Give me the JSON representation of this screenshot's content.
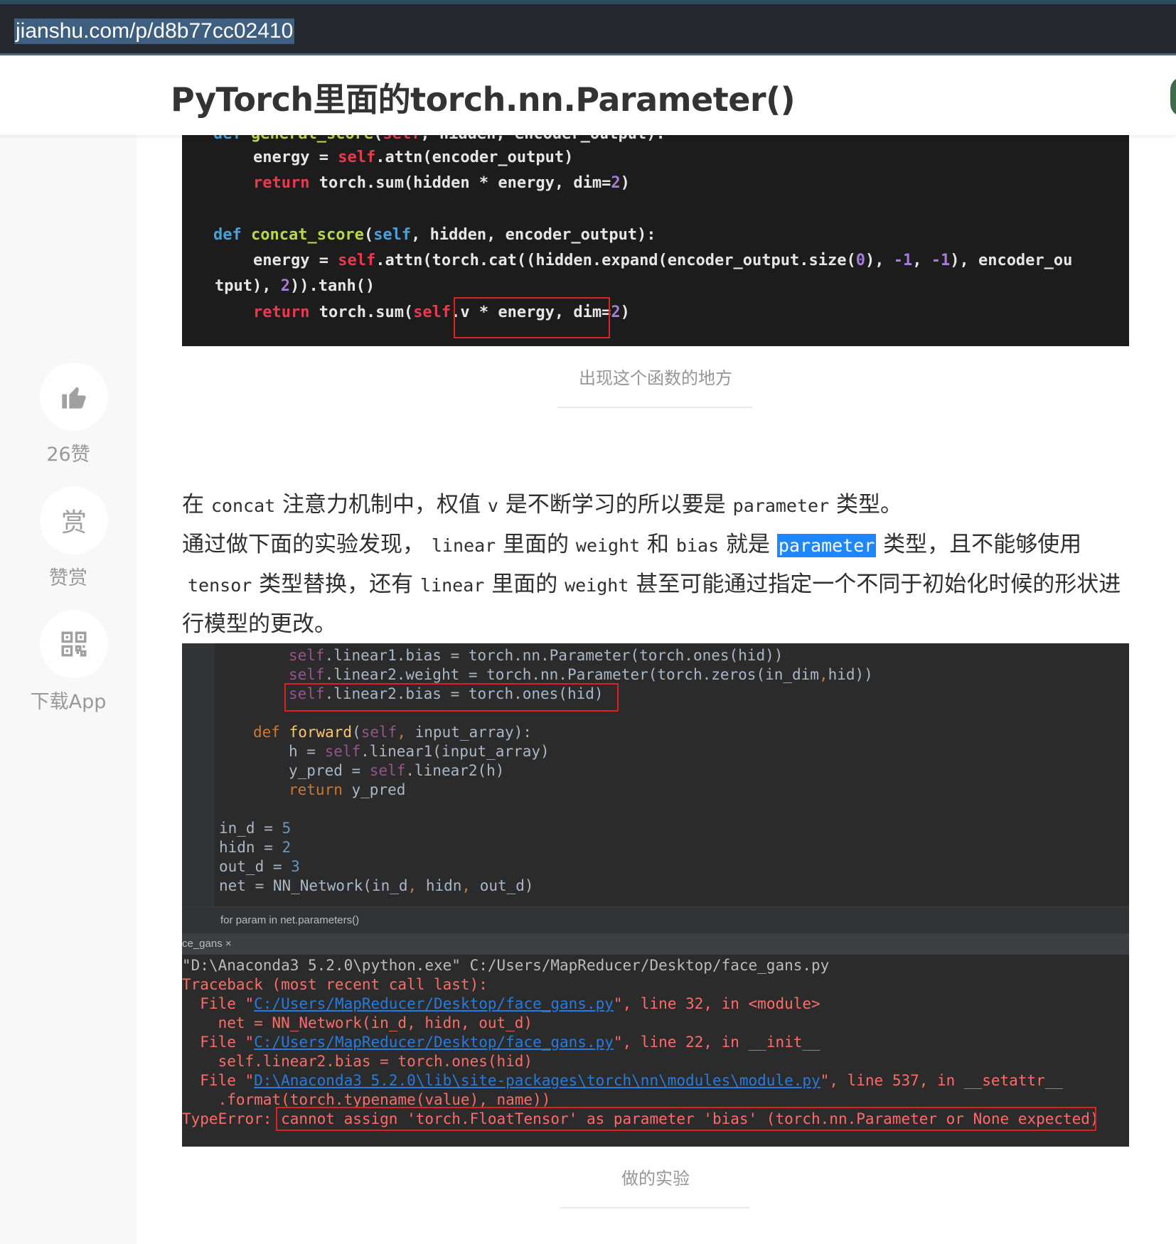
{
  "browser": {
    "url": "jianshu.com/p/d8b77cc02410"
  },
  "header": {
    "title": "PyTorch里面的torch.nn.Parameter()"
  },
  "sidebar": {
    "like_count": "26赞",
    "reward_label": "赞赏",
    "reward_icon_char": "赏",
    "download_label": "下载App"
  },
  "code_block_1": {
    "lines": [
      "    def general_score(self, hidden, encoder_output):",
      "        energy = self.attn(encoder_output)",
      "        return torch.sum(hidden * energy, dim=2)",
      "",
      "    def concat_score(self, hidden, encoder_output):",
      "        energy = self.attn(torch.cat((hidden.expand(encoder_output.size(0), -1, -1), encoder_ou",
      "tput), 2)).tanh()",
      "        return torch.sum(self.v * energy, dim=2)"
    ]
  },
  "caption_1": "出现这个函数的地方",
  "paragraph": {
    "p1_a": "在 ",
    "p1_code1": "concat",
    "p1_b": " 注意力机制中，权值 ",
    "p1_code2": "v",
    "p1_c": " 是不断学习的所以要是 ",
    "p1_code3": "parameter",
    "p1_d": " 类型。",
    "p2_a": "通过做下面的实验发现， ",
    "p2_code1": "linear",
    "p2_b": " 里面的 ",
    "p2_code2": "weight",
    "p2_c": " 和 ",
    "p2_code3": "bias",
    "p2_d": " 就是 ",
    "p2_hl": "parameter",
    "p2_e": " 类型，且不能够使用",
    "p3_code1": "tensor",
    "p3_a": " 类型替换，还有 ",
    "p3_code2": "linear",
    "p3_b": " 里面的 ",
    "p3_code3": "weight",
    "p3_c": " 甚至可能通过指定一个不同于初始化时候的形状进",
    "p4": "行模型的更改。"
  },
  "code_block_2": {
    "l1": "        self.linear1.bias = torch.nn.Parameter(torch.ones(hid))",
    "l2": "        self.linear2.weight = torch.nn.Parameter(torch.zeros(in_dim,hid))",
    "l3": "        self.linear2.bias = torch.ones(hid)",
    "l4": "    def forward(self, input_array):",
    "l5": "        h = self.linear1(input_array)",
    "l6": "        y_pred = self.linear2(h)",
    "l7": "        return y_pred",
    "l8": "in_d = 5",
    "l9": "hidn = 2",
    "l10": "out_d = 3",
    "l11": "net = NN_Network(in_d, hidn, out_d)",
    "tip": "for param in net.parameters()",
    "tab": "ce_gans ×",
    "o1": "\"D:\\Anaconda3 5.2.0\\python.exe\" C:/Users/MapReducer/Desktop/face_gans.py",
    "o2": "Traceback (most recent call last):",
    "o3_a": "  File \"",
    "o3_link": "C:/Users/MapReducer/Desktop/face_gans.py",
    "o3_b": "\", line 32, in <module>",
    "o4": "    net = NN_Network(in_d, hidn, out_d)",
    "o5_a": "  File \"",
    "o5_link": "C:/Users/MapReducer/Desktop/face_gans.py",
    "o5_b": "\", line 22, in __init__",
    "o6": "    self.linear2.bias = torch.ones(hid)",
    "o7_a": "  File \"",
    "o7_link": "D:\\Anaconda3 5.2.0\\lib\\site-packages\\torch\\nn\\modules\\module.py",
    "o7_b": "\", line 537, in __setattr__",
    "o8": "    .format(torch.typename(value), name))",
    "o9_a": "TypeError: ",
    "o9_b": "cannot assign 'torch.FloatTensor' as parameter 'bias' (torch.nn.Parameter or None expected)"
  },
  "caption_2": "做的实验"
}
